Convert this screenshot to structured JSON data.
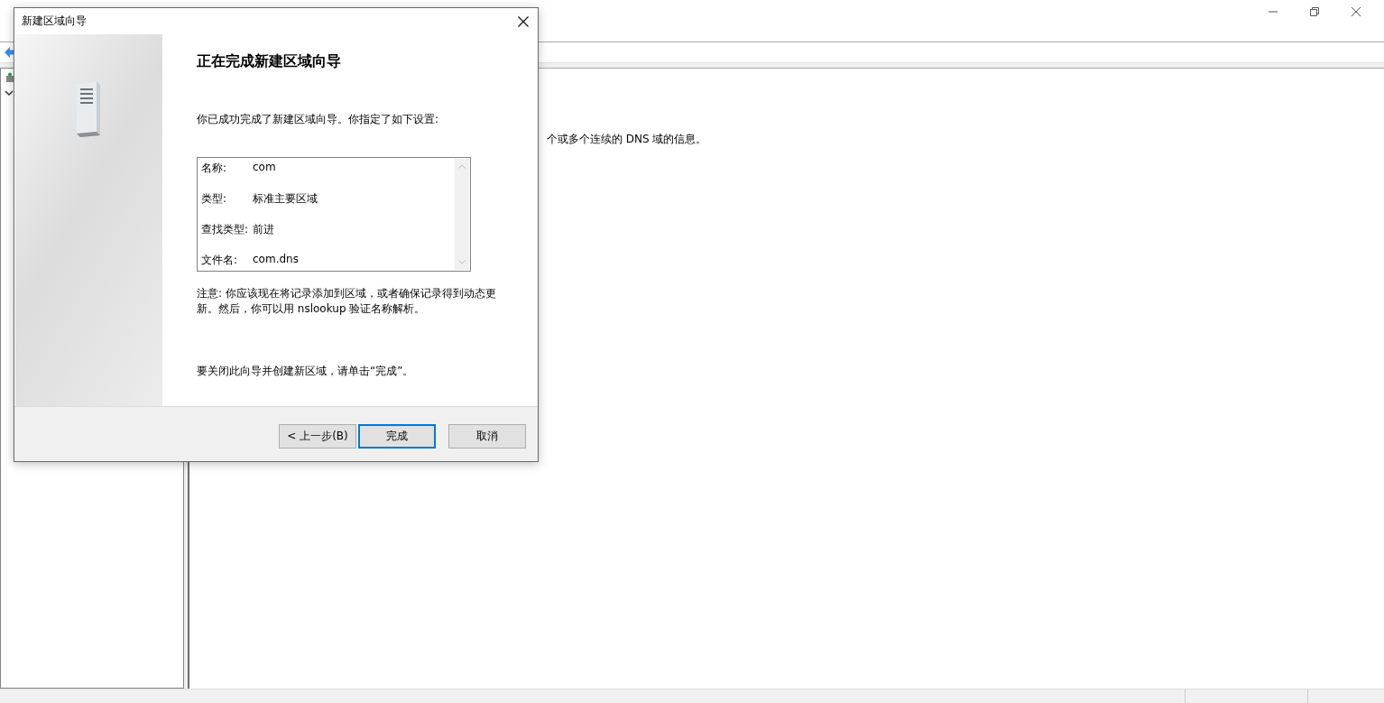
{
  "app": {
    "content_text": "个或多个连续的 DNS 域的信息。"
  },
  "dialog": {
    "title": "新建区域向导",
    "heading": "正在完成新建区域向导",
    "intro": "你已成功完成了新建区域向导。你指定了如下设置:",
    "summary": [
      {
        "label": "名称:",
        "value": "com"
      },
      {
        "label": "类型:",
        "value": "标准主要区域"
      },
      {
        "label": "查找类型:",
        "value": "前进"
      },
      {
        "label": "文件名:",
        "value": "com.dns"
      }
    ],
    "note": "注意: 你应该现在将记录添加到区域，或者确保记录得到动态更新。然后，你可以用 nslookup 验证名称解析。",
    "closing": "要关闭此向导并创建新区域，请单击“完成”。",
    "buttons": [
      {
        "label": "< 上一步(B)",
        "focused": false
      },
      {
        "label": "完成",
        "focused": true
      },
      {
        "label": "取消",
        "focused": false
      }
    ]
  }
}
